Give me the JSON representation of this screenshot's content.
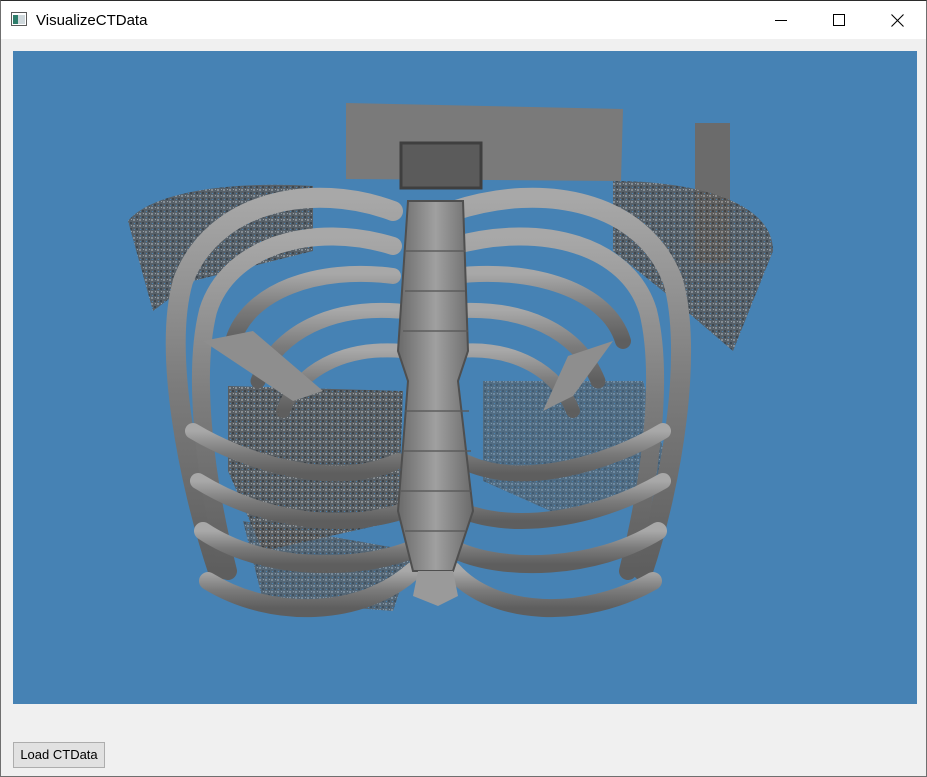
{
  "window": {
    "title": "VisualizeCTData",
    "app_icon": "window-app-icon",
    "controls": {
      "minimize_icon": "minimize-icon",
      "maximize_icon": "maximize-icon",
      "close_icon": "close-icon"
    }
  },
  "viewport": {
    "background_color": "#4682b4",
    "content": "3D volume rendering of thoracic CT scan (rib cage)"
  },
  "toolbar": {
    "load_label": "Load CTData"
  },
  "colors": {
    "titlebar": "#ffffff",
    "window_bg": "#f0f0f0",
    "bone": "#8a8a8a"
  }
}
